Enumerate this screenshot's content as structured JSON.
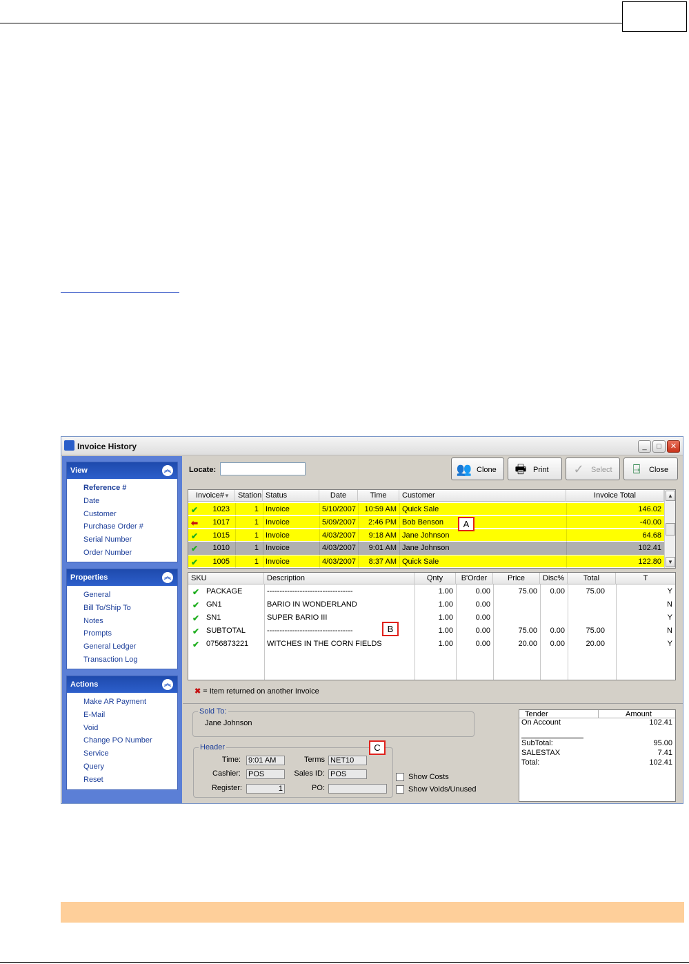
{
  "window": {
    "title": "Invoice History",
    "controls": {
      "minimize": "_",
      "maximize": "□",
      "close": "✕"
    }
  },
  "sidebar": {
    "view": {
      "title": "View",
      "items": [
        "Reference #",
        "Date",
        "Customer",
        "Purchase Order #",
        "Serial Number",
        "Order Number"
      ]
    },
    "properties": {
      "title": "Properties",
      "items": [
        "General",
        "Bill To/Ship To",
        "Notes",
        "Prompts",
        "General Ledger",
        "Transaction Log"
      ]
    },
    "actions": {
      "title": "Actions",
      "items": [
        "Make AR Payment",
        "E-Mail",
        "Void",
        "Change PO Number",
        "Service",
        "Query",
        "Reset"
      ]
    }
  },
  "toolbar": {
    "locate_label": "Locate:",
    "locate_value": "",
    "clone": "Clone",
    "print": "Print",
    "select": "Select",
    "close": "Close"
  },
  "invoices": {
    "columns": [
      "Invoice#",
      "Station",
      "Status",
      "Date",
      "Time",
      "Customer",
      "Invoice Total"
    ],
    "rows": [
      {
        "mark": "✔",
        "invoice": "1023",
        "station": "1",
        "status": "Invoice",
        "date": "5/10/2007",
        "time": "10:59 AM",
        "customer": "Quick Sale",
        "total": "146.02"
      },
      {
        "mark": "⬅",
        "invoice": "1017",
        "station": "1",
        "status": "Invoice",
        "date": "5/09/2007",
        "time": "2:46 PM",
        "customer": "Bob Benson",
        "total": "-40.00"
      },
      {
        "mark": "✔",
        "invoice": "1015",
        "station": "1",
        "status": "Invoice",
        "date": "4/03/2007",
        "time": "9:18 AM",
        "customer": "Jane Johnson",
        "total": "64.68"
      },
      {
        "mark": "✔",
        "invoice": "1010",
        "station": "1",
        "status": "Invoice",
        "date": "4/03/2007",
        "time": "9:01 AM",
        "customer": "Jane Johnson",
        "total": "102.41"
      },
      {
        "mark": "✔",
        "invoice": "1005",
        "station": "1",
        "status": "Invoice",
        "date": "4/03/2007",
        "time": "8:37 AM",
        "customer": "Quick Sale",
        "total": "122.80"
      }
    ]
  },
  "items": {
    "columns": [
      "SKU",
      "Description",
      "Qnty",
      "B'Order",
      "Price",
      "Disc%",
      "Total",
      "T"
    ],
    "rows": [
      {
        "mark": "✔",
        "sku": "PACKAGE",
        "desc": "----------------------------------",
        "qty": "1.00",
        "border": "0.00",
        "price": "75.00",
        "disc": "0.00",
        "total": "75.00",
        "t": "Y"
      },
      {
        "mark": "✔",
        "sku": "GN1",
        "desc": "BARIO IN WONDERLAND",
        "qty": "1.00",
        "border": "0.00",
        "price": "",
        "disc": "",
        "total": "",
        "t": "N"
      },
      {
        "mark": "✔",
        "sku": "SN1",
        "desc": "SUPER BARIO III",
        "qty": "1.00",
        "border": "0.00",
        "price": "",
        "disc": "",
        "total": "",
        "t": "Y"
      },
      {
        "mark": "✔",
        "sku": "SUBTOTAL",
        "desc": "----------------------------------",
        "qty": "1.00",
        "border": "0.00",
        "price": "75.00",
        "disc": "0.00",
        "total": "75.00",
        "t": "N"
      },
      {
        "mark": "✔",
        "sku": "0756873221",
        "desc": "WITCHES IN THE CORN FIELDS",
        "qty": "1.00",
        "border": "0.00",
        "price": "20.00",
        "disc": "0.00",
        "total": "20.00",
        "t": "Y"
      }
    ]
  },
  "legend": "= Item returned on another Invoice",
  "callouts": {
    "a": "A",
    "b": "B",
    "c": "C"
  },
  "sold_to": {
    "title": "Sold To:",
    "name": "Jane Johnson"
  },
  "header": {
    "title": "Header",
    "time_label": "Time:",
    "time": "9:01 AM",
    "cashier_label": "Cashier:",
    "cashier": "POS",
    "register_label": "Register:",
    "register": "1",
    "terms_label": "Terms",
    "terms": "NET10",
    "sales_id_label": "Sales ID:",
    "sales_id": "POS",
    "po_label": "PO:",
    "po": ""
  },
  "options": {
    "show_costs": "Show Costs",
    "show_voids": "Show Voids/Unused"
  },
  "tender": {
    "col_tender": "Tender",
    "col_amount": "Amount",
    "on_account_label": "On Account",
    "on_account": "102.41",
    "subtotal_label": "SubTotal:",
    "subtotal": "95.00",
    "salestax_label": "SALESTAX",
    "salestax": "7.41",
    "total_label": "Total:",
    "total": "102.41"
  },
  "colors": {
    "highlight": "#ffff00",
    "selected": "#b0b0b0",
    "nav_blue": "#2d5fcb",
    "callout_red": "#e0221d",
    "footer_bar": "#fecf9a"
  }
}
